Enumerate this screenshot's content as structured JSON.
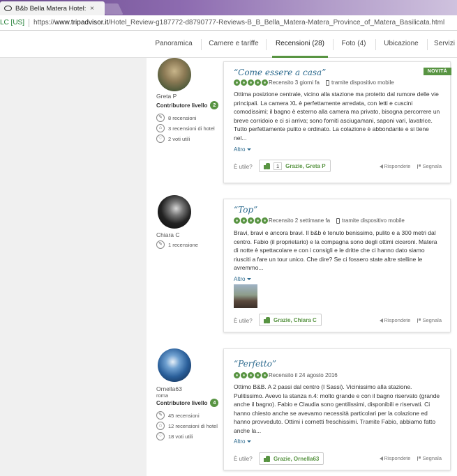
{
  "browser": {
    "tab_title": "B&b Bella Matera Hotel:",
    "tab_close": "×",
    "secure_label": "LC [US]",
    "url_scheme": "https://",
    "url_domain": "www.tripadvisor.it",
    "url_path": "/Hotel_Review-g187772-d8790777-Reviews-B_B_Bella_Matera-Matera_Province_of_Matera_Basilicata.html"
  },
  "nav": {
    "tabs": [
      {
        "label": "Panoramica"
      },
      {
        "label": "Camere e tariffe"
      },
      {
        "label": "Recensioni (28)"
      },
      {
        "label": "Foto (4)"
      },
      {
        "label": "Ubicazione"
      },
      {
        "label": "Servizi"
      }
    ]
  },
  "reviews": [
    {
      "user_name": "Greta P",
      "user_location": "",
      "level_label": "Contributore livello",
      "level": "2",
      "stats": [
        "8 recensioni",
        "3 recensioni di hotel",
        "2 voti utili"
      ],
      "title": "“Come essere a casa”",
      "reviewed": "Recensito 3 giorni fa",
      "device": "tramite dispositivo mobile",
      "badge": "NOVITÀ",
      "body": "Ottima posizione centrale, vicino alla stazione ma protetto dal rumore delle vie principali. La camera XL è perfettamente arredata, con letti e cuscini comodissimi; il bagno è esterno alla camera ma privato, bisogna percorrere un breve corridoio e ci si arriva; sono forniti asciugamani, saponi vari, lavatrice. Tutto perfettamente pulito e ordinato. La colazione è abbondante e si tiene nel...",
      "more": "Altro",
      "useful": "È utile?",
      "thanks_count": "1",
      "thanks": "Grazie, Greta P",
      "reply": "Rispondete",
      "report": "Segnala"
    },
    {
      "user_name": "Chiara C",
      "user_location": "",
      "stats": [
        "1 recensione"
      ],
      "title": "“Top”",
      "reviewed": "Recensito 2 settimane fa",
      "device": "tramite dispositivo mobile",
      "body": "Bravi, bravi e ancora bravi. Il b&b è tenuto benissimo, pulito e a 300 metri dal centro. Fabio (il proprietario) e la compagna sono degli ottimi ciceroni. Matera di notte è spettacolare e con i consigli e le dritte che ci hanno dato siamo riusciti a fare un tour unico. Che dire? Se ci fossero state altre stelline le avremmo...",
      "more": "Altro",
      "useful": "È utile?",
      "thanks": "Grazie, Chiara C",
      "reply": "Rispondete",
      "report": "Segnala"
    },
    {
      "user_name": "Ornella63",
      "user_location": "roma",
      "level_label": "Contributore livello",
      "level": "4",
      "stats": [
        "45 recensioni",
        "12 recensioni di hotel",
        "18 voti utili"
      ],
      "title": "“Perfetto”",
      "reviewed": "Recensito il 24 agosto 2016",
      "body": "Ottimo B&B. A 2 passi dal centro (I Sassi). Vicinissimo alla stazione. Pulitissimo. Avevo la stanza n.4: molto grande e con il bagno riservato (grande anche il bagno). Fabio e Claudia sono gentilissimi, disponibili e riservati. Ci hanno chiesto anche se avevamo necessità particolari per la colazione ed hanno provveduto. Ottimi i cornetti freschissimi. Tramite Fabio, abbiamo fatto anche la...",
      "more": "Altro",
      "useful": "È utile?",
      "thanks": "Grazie, Ornella63",
      "reply": "Rispondete",
      "report": "Segnala"
    }
  ],
  "colors": {
    "accent_green": "#589442",
    "title_blue": "#2c6a8e"
  }
}
